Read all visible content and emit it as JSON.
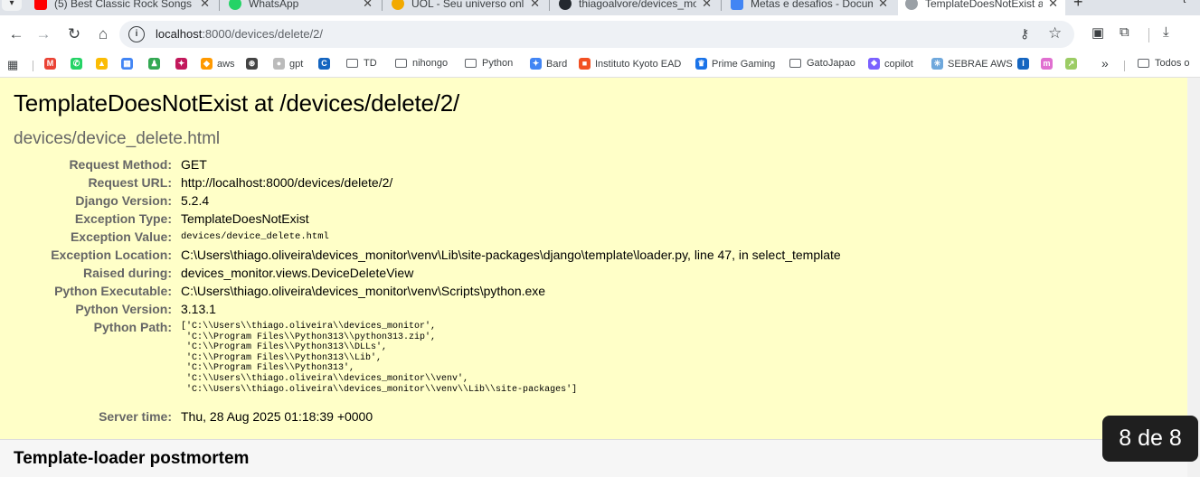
{
  "browser": {
    "tabs": [
      {
        "title": "(5) Best Classic Rock Songs",
        "fav_color": "#ff0000"
      },
      {
        "title": "WhatsApp",
        "fav_color": "#25d366"
      },
      {
        "title": "UOL - Seu universo online",
        "fav_color": "#f2a900"
      },
      {
        "title": "thiagoalvore/devices_moni",
        "fav_color": "#24292f"
      },
      {
        "title": "Metas e desafios - Docum",
        "fav_color": "#4285f4"
      },
      {
        "title": "TemplateDoesNotExist at /",
        "fav_color": "#9aa0a6"
      }
    ],
    "tab_right_label": "t",
    "url_host": "localhost",
    "url_rest": ":8000/devices/delete/2/",
    "bookmarks": [
      {
        "label": "",
        "icon": "gmail-icon",
        "color": "#ea4335",
        "glyph": "M"
      },
      {
        "label": "",
        "icon": "whatsapp-icon",
        "color": "#25d366",
        "glyph": "✆"
      },
      {
        "label": "",
        "icon": "drive-icon",
        "color": "#fbbc04",
        "glyph": "▲"
      },
      {
        "label": "",
        "icon": "calendar-icon",
        "color": "#4285f4",
        "glyph": "▦"
      },
      {
        "label": "",
        "icon": "figure-icon",
        "color": "#34a853",
        "glyph": "♟"
      },
      {
        "label": "",
        "icon": "game-icon",
        "color": "#c2185b",
        "glyph": "✦"
      },
      {
        "label": "aws",
        "icon": "aws-icon",
        "color": "#ff9900",
        "glyph": "◆"
      },
      {
        "label": "",
        "icon": "openai-icon",
        "color": "#444444",
        "glyph": "⊛"
      },
      {
        "label": "gpt",
        "icon": "gpt-icon",
        "color": "#bbbbbb",
        "glyph": "●"
      },
      {
        "label": "",
        "icon": "c-icon",
        "color": "#1565c0",
        "glyph": "C"
      },
      {
        "label": "TD",
        "icon": "folder-icon",
        "folder": true
      },
      {
        "label": "nihongo",
        "icon": "folder-icon",
        "folder": true
      },
      {
        "label": "Python",
        "icon": "folder-icon",
        "folder": true
      },
      {
        "label": "Bard",
        "icon": "bard-icon",
        "color": "#4285f4",
        "glyph": "✦"
      },
      {
        "label": "Instituto Kyoto EAD",
        "icon": "microsoft-icon",
        "color": "#f25022",
        "glyph": "■"
      },
      {
        "label": "Prime Gaming",
        "icon": "crown-icon",
        "color": "#1a73e8",
        "glyph": "♛"
      },
      {
        "label": "GatoJapao",
        "icon": "folder-icon",
        "folder": true
      },
      {
        "label": "copilot",
        "icon": "copilot-icon",
        "color": "#7b61ff",
        "glyph": "❖"
      },
      {
        "label": "SEBRAE AWS",
        "icon": "sebrae-icon",
        "color": "#6fa8dc",
        "glyph": "✳"
      },
      {
        "label": "",
        "icon": "info-icon",
        "color": "#1565c0",
        "glyph": "I"
      },
      {
        "label": "",
        "icon": "m-icon",
        "color": "#e06fd0",
        "glyph": "m"
      },
      {
        "label": "",
        "icon": "chart-icon",
        "color": "#9ccc65",
        "glyph": "↗"
      }
    ],
    "more_label": "»",
    "all_bookmarks_label": "Todos o"
  },
  "error_page": {
    "title": "TemplateDoesNotExist at /devices/delete/2/",
    "subtitle": "devices/device_delete.html",
    "fields": [
      {
        "key": "Request Method:",
        "value": "GET"
      },
      {
        "key": "Request URL:",
        "value": "http://localhost:8000/devices/delete/2/"
      },
      {
        "key": "Django Version:",
        "value": "5.2.4"
      },
      {
        "key": "Exception Type:",
        "value": "TemplateDoesNotExist"
      },
      {
        "key": "Exception Value:",
        "value": "devices/device_delete.html"
      },
      {
        "key": "Exception Location:",
        "value": "C:\\Users\\thiago.oliveira\\devices_monitor\\venv\\Lib\\site-packages\\django\\template\\loader.py, line 47, in select_template"
      },
      {
        "key": "Raised during:",
        "value": "devices_monitor.views.DeviceDeleteView"
      },
      {
        "key": "Python Executable:",
        "value": "C:\\Users\\thiago.oliveira\\devices_monitor\\venv\\Scripts\\python.exe"
      },
      {
        "key": "Python Version:",
        "value": "3.13.1"
      },
      {
        "key": "Python Path:",
        "value": "['C:\\\\Users\\\\thiago.oliveira\\\\devices_monitor',\n 'C:\\\\Program Files\\\\Python313\\\\python313.zip',\n 'C:\\\\Program Files\\\\Python313\\\\DLLs',\n 'C:\\\\Program Files\\\\Python313\\\\Lib',\n 'C:\\\\Program Files\\\\Python313',\n 'C:\\\\Users\\\\thiago.oliveira\\\\devices_monitor\\\\venv',\n 'C:\\\\Users\\\\thiago.oliveira\\\\devices_monitor\\\\venv\\\\Lib\\\\site-packages']"
      },
      {
        "key": "Server time:",
        "value": "Thu, 28 Aug 2025 01:18:39 +0000"
      }
    ],
    "postmortem_title": "Template-loader postmortem"
  },
  "overlay": {
    "counter": "8 de 8"
  }
}
